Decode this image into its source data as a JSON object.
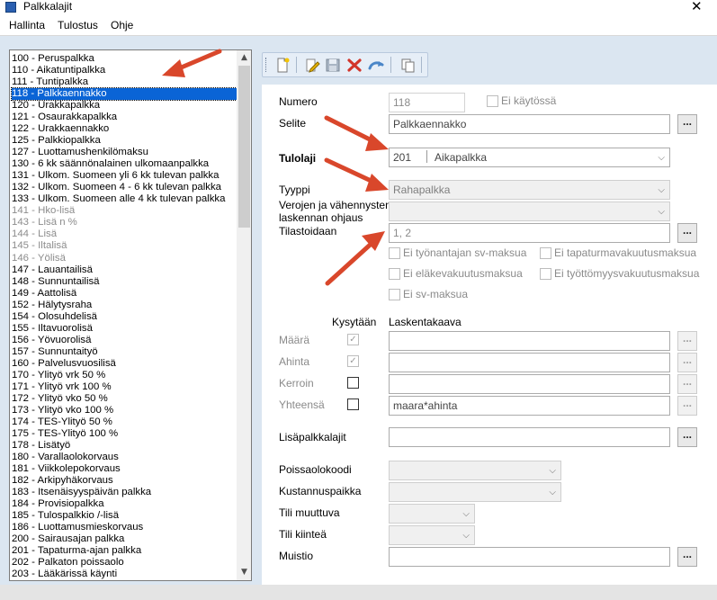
{
  "window": {
    "title": "Palkkalajit",
    "close": "✕"
  },
  "menu": [
    "Hallinta",
    "Tulostus",
    "Ohje"
  ],
  "list": {
    "selected_index": 3,
    "disabled_indices": [
      13,
      14,
      15,
      16,
      17
    ],
    "items": [
      "100 - Peruspalkka",
      "110 - Aikatuntipalkka",
      "111 - Tuntipalkka",
      "118 - Palkkaennakko",
      "120 - Urakkapalkka",
      "121 - Osaurakkapalkka",
      "122 - Urakkaennakko",
      "125 - Palkkiopalkka",
      "127 - Luottamushenkilömaksu",
      "130 - 6 kk säännönalainen ulkomaanpalkka",
      "131 - Ulkom. Suomeen yli 6 kk tulevan palkka",
      "132 - Ulkom. Suomeen 4 - 6 kk tulevan palkka",
      "133 - Ulkom. Suomeen alle 4 kk tulevan palkka",
      "141 - Hko-lisä",
      "143 - Lisä n %",
      "144 - Lisä",
      "145 - Iltalisä",
      "146 - Yölisä",
      "147 - Lauantailisä",
      "148 - Sunnuntailisä",
      "149 - Aattolisä",
      "152 - Hälytysraha",
      "154 - Olosuhdelisä",
      "155 - Iltavuorolisä",
      "156 - Yövuorolisä",
      "157 - Sunnuntaityö",
      "160 - Palvelusvuosilisä",
      "170 - Ylityö vrk 50 %",
      "171 - Ylityö vrk 100 %",
      "172 - Ylityö vko 50 %",
      "173 - Ylityö vko 100 %",
      "174 - TES-Ylityö 50 %",
      "175 - TES-Ylityö 100 %",
      "178 - Lisätyö",
      "180 - Varallaolokorvaus",
      "181 - Viikkolepokorvaus",
      "182 - Arkipyhäkorvaus",
      "183 - Itsenäisyyspäivän palkka",
      "184 - Provisiopalkka",
      "185 - Tulospalkkio /-lisä",
      "186 - Luottamusmieskorvaus",
      "200 - Sairausajan palkka",
      "201 - Tapaturma-ajan palkka",
      "202 - Palkaton poissaolo",
      "203 - Lääkärissä käynti"
    ]
  },
  "toolbar": {
    "icons": [
      "new-document-icon",
      "edit-icon",
      "save-icon",
      "delete-icon",
      "undo-icon",
      "copy-icon"
    ]
  },
  "form": {
    "numero": {
      "label": "Numero",
      "value": "118"
    },
    "ei_kaytossa": {
      "label": "Ei käytössä",
      "checked": false
    },
    "selite": {
      "label": "Selite",
      "value": "Palkkaennakko"
    },
    "tulolaji": {
      "label": "Tulolaji",
      "code": "201",
      "name": "Aikapalkka"
    },
    "tyyppi": {
      "label": "Tyyppi",
      "value": "Rahapalkka"
    },
    "verojen": {
      "label_line1": "Verojen ja vähennysten",
      "label_line2": "laskennan ohjaus",
      "value": ""
    },
    "tilastoidaan": {
      "label": "Tilastoidaan",
      "value": "1, 2"
    },
    "ellipsis": "...",
    "checks": {
      "tyonantajan": "Ei työnantajan sv-maksua",
      "tapaturma": "Ei tapaturmavakuutusmaksua",
      "elake": "Ei eläkevakuutusmaksua",
      "tyottomyys": "Ei työttömyysvakuutusmaksua",
      "sv": "Ei sv-maksua"
    },
    "kysytaan_header": "Kysytään",
    "laskentakaava_header": "Laskentakaava",
    "maara": {
      "label": "Määrä",
      "asked": true,
      "formula": ""
    },
    "ahinta": {
      "label": "Ahinta",
      "asked": true,
      "formula": ""
    },
    "kerroin": {
      "label": "Kerroin",
      "asked": false,
      "formula": ""
    },
    "yhteensa": {
      "label": "Yhteensä",
      "asked": false,
      "formula": "maara*ahinta"
    },
    "lisapalkkalajit": {
      "label": "Lisäpalkkalajit",
      "value": ""
    },
    "poissaolokoodi": {
      "label": "Poissaolokoodi",
      "value": ""
    },
    "kustannuspaikka": {
      "label": "Kustannuspaikka",
      "value": ""
    },
    "tili_muuttuva": {
      "label": "Tili muuttuva",
      "value": ""
    },
    "tili_kiintea": {
      "label": "Tili kiinteä",
      "value": ""
    },
    "muistio": {
      "label": "Muistio",
      "value": ""
    }
  },
  "colors": {
    "selection": "#0a64d6",
    "annotation_arrow": "#d9472b",
    "background": "#dbe6f1"
  }
}
